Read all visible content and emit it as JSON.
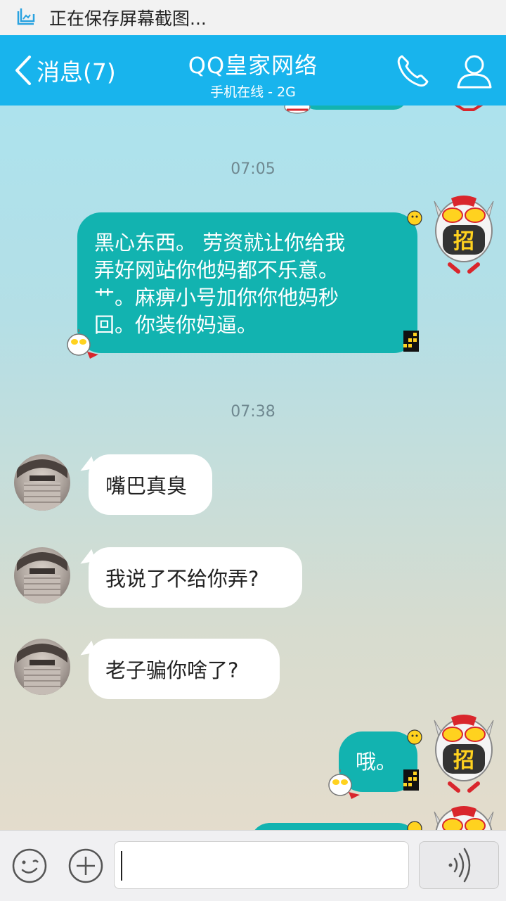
{
  "status_bar": {
    "text": "正在保存屏幕截图..."
  },
  "header": {
    "back_label": "消息(7)",
    "title": "QQ皇家网络",
    "subtitle": "手机在线 - 2G"
  },
  "chat": {
    "timestamps": [
      "07:05",
      "07:38"
    ],
    "messages": [
      {
        "direction": "out",
        "lines": [
          "黑心东西。  劳资就让你给我",
          "弄好网站你他妈都不乐意。",
          "艹。麻痹小号加你你他妈秒",
          "回。你装你妈逼。"
        ]
      },
      {
        "direction": "in",
        "text": "嘴巴真臭"
      },
      {
        "direction": "in",
        "text": "我说了不给你弄?"
      },
      {
        "direction": "in",
        "text": "老子骗你啥了?"
      },
      {
        "direction": "out",
        "text": "哦。"
      }
    ],
    "avatar_badge_text": "招"
  },
  "input_bar": {
    "value": "",
    "placeholder": ""
  },
  "colors": {
    "header": "#18b4ed",
    "outgoing_bubble": "#12b3b0",
    "incoming_bubble": "#ffffff"
  },
  "icons": {
    "status": "screenshot-icon",
    "back": "chevron-left-icon",
    "phone": "phone-icon",
    "profile": "person-icon",
    "emoji": "emoji-icon",
    "plus": "plus-icon",
    "voice": "voice-wave-icon"
  }
}
